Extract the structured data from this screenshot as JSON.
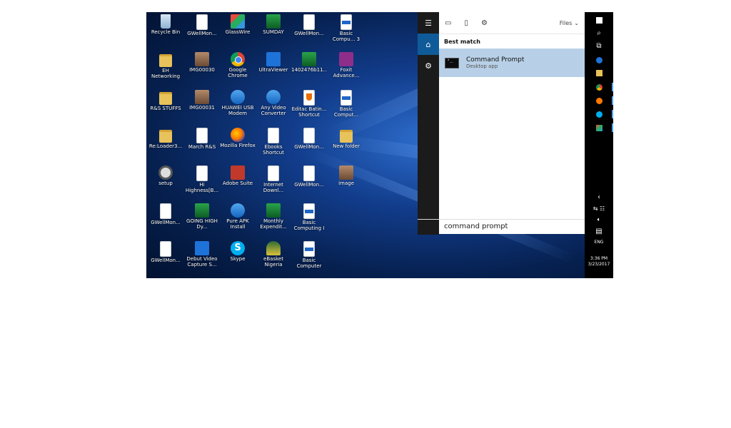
{
  "desktop": {
    "icons": [
      {
        "label": "Recycle Bin",
        "icon": "recycle-bin-icon",
        "kind": "trash"
      },
      {
        "label": "GWellMon...",
        "icon": "document-icon",
        "kind": "file"
      },
      {
        "label": "GlassWire",
        "icon": "glasswire-icon",
        "kind": "multi"
      },
      {
        "label": "SUMDAY",
        "icon": "sumday-icon",
        "kind": "green"
      },
      {
        "label": "GWellMon...",
        "icon": "document-icon",
        "kind": "file"
      },
      {
        "label": "Basic Compu... 3",
        "icon": "pdf-icon",
        "kind": "pdf"
      },
      {
        "label": "EH Networking",
        "icon": "archive-icon",
        "kind": "folder"
      },
      {
        "label": "IMG00030",
        "icon": "photo-icon",
        "kind": "photo"
      },
      {
        "label": "Google Chrome",
        "icon": "chrome-icon",
        "kind": "chrome"
      },
      {
        "label": "UltraViewer",
        "icon": "ultraviewer-icon",
        "kind": "blue"
      },
      {
        "label": "1402476b11...",
        "icon": "image-icon",
        "kind": "green"
      },
      {
        "label": "Foxit Advance...",
        "icon": "foxit-icon",
        "kind": "purple"
      },
      {
        "label": "R&S STUFFS",
        "icon": "archive-icon",
        "kind": "folder"
      },
      {
        "label": "IMG00031",
        "icon": "photo-icon",
        "kind": "photo"
      },
      {
        "label": "HUAWEI USB Modem",
        "icon": "huawei-icon",
        "kind": "sky"
      },
      {
        "label": "Any Video Converter",
        "icon": "video-converter-icon",
        "kind": "sky"
      },
      {
        "label": "Editac Batin... Shortcut",
        "icon": "java-icon",
        "kind": "java"
      },
      {
        "label": "Basic Comput...",
        "icon": "pdf-icon",
        "kind": "pdf"
      },
      {
        "label": "Re:Loader3...",
        "icon": "folder-icon",
        "kind": "folder"
      },
      {
        "label": "March R&S",
        "icon": "spreadsheet-icon",
        "kind": "file"
      },
      {
        "label": "Mozilla Firefox",
        "icon": "firefox-icon",
        "kind": "firefox"
      },
      {
        "label": "Ebooks Shortcut",
        "icon": "shortcut-icon",
        "kind": "file"
      },
      {
        "label": "GWellMon...",
        "icon": "document-icon",
        "kind": "file"
      },
      {
        "label": "New folder",
        "icon": "folder-icon",
        "kind": "folder"
      },
      {
        "label": "setup",
        "icon": "setup-icon",
        "kind": "gear"
      },
      {
        "label": "Hi Highness[B...",
        "icon": "media-file-icon",
        "kind": "file"
      },
      {
        "label": "Adobe Suite",
        "icon": "adobe-icon",
        "kind": "red"
      },
      {
        "label": "Internet Downl...",
        "icon": "download-icon",
        "kind": "file"
      },
      {
        "label": "GWellMon...",
        "icon": "document-icon",
        "kind": "file"
      },
      {
        "label": "image",
        "icon": "photo-icon",
        "kind": "photo"
      },
      {
        "label": "GWellMon...",
        "icon": "document-icon",
        "kind": "file"
      },
      {
        "label": "GOING HIGH Dy...",
        "icon": "video-icon",
        "kind": "green"
      },
      {
        "label": "Pure APK Install",
        "icon": "apk-icon",
        "kind": "sky"
      },
      {
        "label": "Monthly Expendit...",
        "icon": "spreadsheet-icon",
        "kind": "green"
      },
      {
        "label": "Basic Computing I",
        "icon": "pdf-icon",
        "kind": "pdf"
      },
      {
        "label": "GWellMon...",
        "icon": "document-icon",
        "kind": "file"
      },
      {
        "label": "Debut Video Capture S...",
        "icon": "debut-icon",
        "kind": "blue"
      },
      {
        "label": "Skype",
        "icon": "skype-icon",
        "kind": "skype"
      },
      {
        "label": "eBasket Nigeria",
        "icon": "ebasket-icon",
        "kind": "olive"
      },
      {
        "label": "Basic Computer",
        "icon": "pdf-icon",
        "kind": "pdf"
      }
    ]
  },
  "search": {
    "tabs_icons": [
      "apps-icon",
      "documents-icon",
      "settings-icon"
    ],
    "filter_label": "Files",
    "section_title": "Best match",
    "best_match": {
      "title": "Command Prompt",
      "subtitle": "Desktop app"
    },
    "query": "command prompt"
  },
  "taskbar": {
    "time": "3:36 PM",
    "date": "3/23/2017",
    "language": "ENG"
  },
  "colors": {
    "accent": "#0f5b99",
    "selection": "#b8d0e7",
    "taskbar": "#000000"
  }
}
